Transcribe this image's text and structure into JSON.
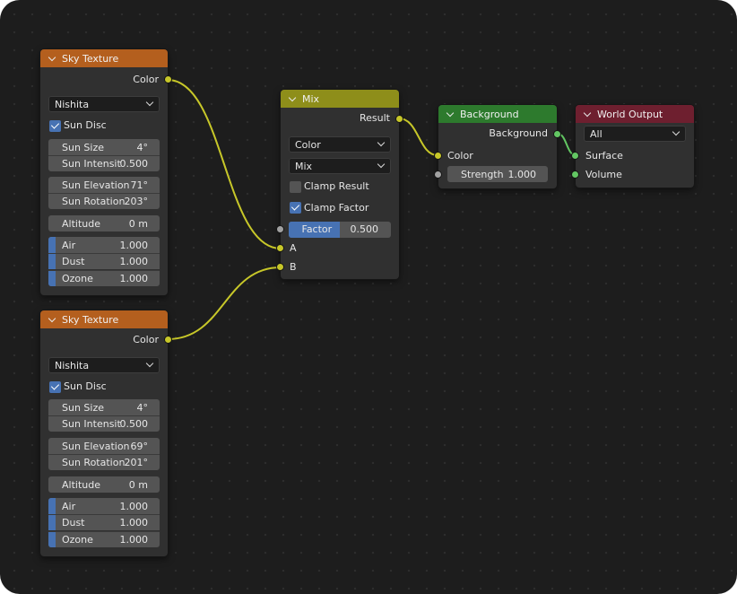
{
  "colors": {
    "editor_bg": "#1d1d1d",
    "node_body": "#303030",
    "texture_header": "#b45f1e",
    "mix_header": "#8e8e1a",
    "shader_header": "#2d7a2d",
    "output_header": "#6e1f2f",
    "socket_color": "#c7c729",
    "socket_float": "#a1a1a1",
    "socket_shader": "#63c763",
    "accent_blue": "#4772b3"
  },
  "sky1": {
    "title": "Sky Texture",
    "output_label": "Color",
    "type_value": "Nishita",
    "sun_disc_label": "Sun Disc",
    "sun_disc_checked": true,
    "sun_size_label": "Sun Size",
    "sun_size_value": "4°",
    "sun_intensity_label": "Sun Intensit",
    "sun_intensity_value": "0.500",
    "sun_elevation_label": "Sun Elevation",
    "sun_elevation_value": "71°",
    "sun_rotation_label": "Sun Rotation",
    "sun_rotation_value": "203°",
    "altitude_label": "Altitude",
    "altitude_value": "0 m",
    "air_label": "Air",
    "air_value": "1.000",
    "dust_label": "Dust",
    "dust_value": "1.000",
    "ozone_label": "Ozone",
    "ozone_value": "1.000"
  },
  "sky2": {
    "title": "Sky Texture",
    "output_label": "Color",
    "type_value": "Nishita",
    "sun_disc_label": "Sun Disc",
    "sun_disc_checked": true,
    "sun_size_label": "Sun Size",
    "sun_size_value": "4°",
    "sun_intensity_label": "Sun Intensit",
    "sun_intensity_value": "0.500",
    "sun_elevation_label": "Sun Elevation",
    "sun_elevation_value": "69°",
    "sun_rotation_label": "Sun Rotation",
    "sun_rotation_value": "201°",
    "altitude_label": "Altitude",
    "altitude_value": "0 m",
    "air_label": "Air",
    "air_value": "1.000",
    "dust_label": "Dust",
    "dust_value": "1.000",
    "ozone_label": "Ozone",
    "ozone_value": "1.000"
  },
  "mix": {
    "title": "Mix",
    "output_label": "Result",
    "data_type_value": "Color",
    "blend_value": "Mix",
    "clamp_result_label": "Clamp Result",
    "clamp_result_checked": false,
    "clamp_factor_label": "Clamp Factor",
    "clamp_factor_checked": true,
    "factor_label": "Factor",
    "factor_value": "0.500",
    "factor_fraction": 0.5,
    "input_a_label": "A",
    "input_b_label": "B"
  },
  "background": {
    "title": "Background",
    "output_label": "Background",
    "color_label": "Color",
    "strength_label": "Strength",
    "strength_value": "1.000"
  },
  "world_output": {
    "title": "World Output",
    "target_value": "All",
    "surface_label": "Surface",
    "volume_label": "Volume"
  }
}
